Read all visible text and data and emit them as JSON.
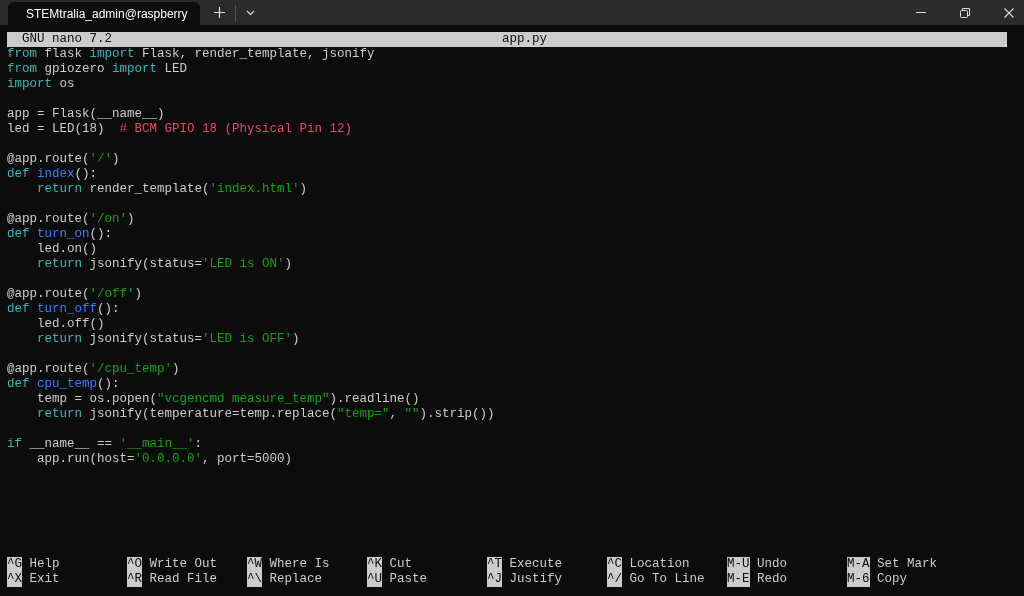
{
  "window": {
    "tab_title": "STEMtralia_admin@raspberry",
    "tab_selected": true
  },
  "nano_header": {
    "version": "GNU nano 7.2",
    "filename": "app.py"
  },
  "code_lines": [
    {
      "kind": "code",
      "segments": [
        {
          "kind": "keyword",
          "text": "from"
        },
        {
          "kind": "plain",
          "text": " flask "
        },
        {
          "kind": "keyword",
          "text": "import"
        },
        {
          "kind": "plain",
          "text": " Flask, render_template, jsonify"
        }
      ]
    },
    {
      "kind": "code",
      "segments": [
        {
          "kind": "keyword",
          "text": "from"
        },
        {
          "kind": "plain",
          "text": " gpiozero "
        },
        {
          "kind": "keyword",
          "text": "import"
        },
        {
          "kind": "plain",
          "text": " LED"
        }
      ]
    },
    {
      "kind": "code",
      "segments": [
        {
          "kind": "keyword",
          "text": "import"
        },
        {
          "kind": "plain",
          "text": " os"
        }
      ]
    },
    {
      "kind": "blank"
    },
    {
      "kind": "code",
      "segments": [
        {
          "kind": "plain",
          "text": "app = Flask(__name__)"
        }
      ]
    },
    {
      "kind": "code",
      "segments": [
        {
          "kind": "plain",
          "text": "led = LED(18)  "
        },
        {
          "kind": "comment",
          "text": "# BCM GPIO 18 (Physical Pin 12)"
        }
      ]
    },
    {
      "kind": "blank"
    },
    {
      "kind": "code",
      "segments": [
        {
          "kind": "plain",
          "text": "@app.route("
        },
        {
          "kind": "string",
          "text": "'/'"
        },
        {
          "kind": "plain",
          "text": ")"
        }
      ]
    },
    {
      "kind": "code",
      "segments": [
        {
          "kind": "keyword",
          "text": "def"
        },
        {
          "kind": "function",
          "text": " index"
        },
        {
          "kind": "plain",
          "text": "():"
        }
      ]
    },
    {
      "kind": "code",
      "segments": [
        {
          "kind": "keyword",
          "text": "    return"
        },
        {
          "kind": "plain",
          "text": " render_template("
        },
        {
          "kind": "string",
          "text": "'index.html'"
        },
        {
          "kind": "plain",
          "text": ")"
        }
      ]
    },
    {
      "kind": "blank"
    },
    {
      "kind": "code",
      "segments": [
        {
          "kind": "plain",
          "text": "@app.route("
        },
        {
          "kind": "string",
          "text": "'/on'"
        },
        {
          "kind": "plain",
          "text": ")"
        }
      ]
    },
    {
      "kind": "code",
      "segments": [
        {
          "kind": "keyword",
          "text": "def"
        },
        {
          "kind": "function",
          "text": " turn_on"
        },
        {
          "kind": "plain",
          "text": "():"
        }
      ]
    },
    {
      "kind": "code",
      "segments": [
        {
          "kind": "plain",
          "text": "    led.on()"
        }
      ]
    },
    {
      "kind": "code",
      "segments": [
        {
          "kind": "keyword",
          "text": "    return"
        },
        {
          "kind": "plain",
          "text": " jsonify(status="
        },
        {
          "kind": "string",
          "text": "'LED is ON'"
        },
        {
          "kind": "plain",
          "text": ")"
        }
      ]
    },
    {
      "kind": "blank"
    },
    {
      "kind": "code",
      "segments": [
        {
          "kind": "plain",
          "text": "@app.route("
        },
        {
          "kind": "string",
          "text": "'/off'"
        },
        {
          "kind": "plain",
          "text": ")"
        }
      ]
    },
    {
      "kind": "code",
      "segments": [
        {
          "kind": "keyword",
          "text": "def"
        },
        {
          "kind": "function",
          "text": " turn_off"
        },
        {
          "kind": "plain",
          "text": "():"
        }
      ]
    },
    {
      "kind": "code",
      "segments": [
        {
          "kind": "plain",
          "text": "    led.off()"
        }
      ]
    },
    {
      "kind": "code",
      "segments": [
        {
          "kind": "keyword",
          "text": "    return"
        },
        {
          "kind": "plain",
          "text": " jsonify(status="
        },
        {
          "kind": "string",
          "text": "'LED is OFF'"
        },
        {
          "kind": "plain",
          "text": ")"
        }
      ]
    },
    {
      "kind": "blank"
    },
    {
      "kind": "code",
      "segments": [
        {
          "kind": "plain",
          "text": "@app.route("
        },
        {
          "kind": "string",
          "text": "'/cpu_temp'"
        },
        {
          "kind": "plain",
          "text": ")"
        }
      ]
    },
    {
      "kind": "code",
      "segments": [
        {
          "kind": "keyword",
          "text": "def"
        },
        {
          "kind": "function",
          "text": " cpu_temp"
        },
        {
          "kind": "plain",
          "text": "():"
        }
      ]
    },
    {
      "kind": "code",
      "segments": [
        {
          "kind": "plain",
          "text": "    temp = os.popen("
        },
        {
          "kind": "string",
          "text": "\"vcgencmd measure_temp\""
        },
        {
          "kind": "plain",
          "text": ").readline()"
        }
      ]
    },
    {
      "kind": "code",
      "segments": [
        {
          "kind": "keyword",
          "text": "    return"
        },
        {
          "kind": "plain",
          "text": " jsonify(temperature=temp.replace("
        },
        {
          "kind": "string",
          "text": "\"temp=\""
        },
        {
          "kind": "plain",
          "text": ", "
        },
        {
          "kind": "string",
          "text": "\"\""
        },
        {
          "kind": "plain",
          "text": ").strip())"
        }
      ]
    },
    {
      "kind": "blank"
    },
    {
      "kind": "code",
      "segments": [
        {
          "kind": "keyword",
          "text": "if"
        },
        {
          "kind": "plain",
          "text": " __name__ == "
        },
        {
          "kind": "string",
          "text": "'__main__'"
        },
        {
          "kind": "plain",
          "text": ":"
        }
      ]
    },
    {
      "kind": "code",
      "segments": [
        {
          "kind": "plain",
          "text": "    app.run(host="
        },
        {
          "kind": "string",
          "text": "'0.0.0.0'"
        },
        {
          "kind": "plain",
          "text": ", port=5000)"
        }
      ]
    }
  ],
  "shortcuts": [
    [
      {
        "key": "^G",
        "label": "Help"
      },
      {
        "key": "^X",
        "label": "Exit"
      }
    ],
    [
      {
        "key": "^O",
        "label": "Write Out"
      },
      {
        "key": "^R",
        "label": "Read File"
      }
    ],
    [
      {
        "key": "^W",
        "label": "Where Is"
      },
      {
        "key": "^\\",
        "label": "Replace"
      }
    ],
    [
      {
        "key": "^K",
        "label": "Cut"
      },
      {
        "key": "^U",
        "label": "Paste"
      }
    ],
    [
      {
        "key": "^T",
        "label": "Execute"
      },
      {
        "key": "^J",
        "label": "Justify"
      }
    ],
    [
      {
        "key": "^C",
        "label": "Location"
      },
      {
        "key": "^/",
        "label": "Go To Line"
      }
    ],
    [
      {
        "key": "M-U",
        "label": "Undo"
      },
      {
        "key": "M-E",
        "label": "Redo"
      }
    ],
    [
      {
        "key": "M-A",
        "label": "Set Mark"
      },
      {
        "key": "M-6",
        "label": "Copy"
      }
    ]
  ]
}
